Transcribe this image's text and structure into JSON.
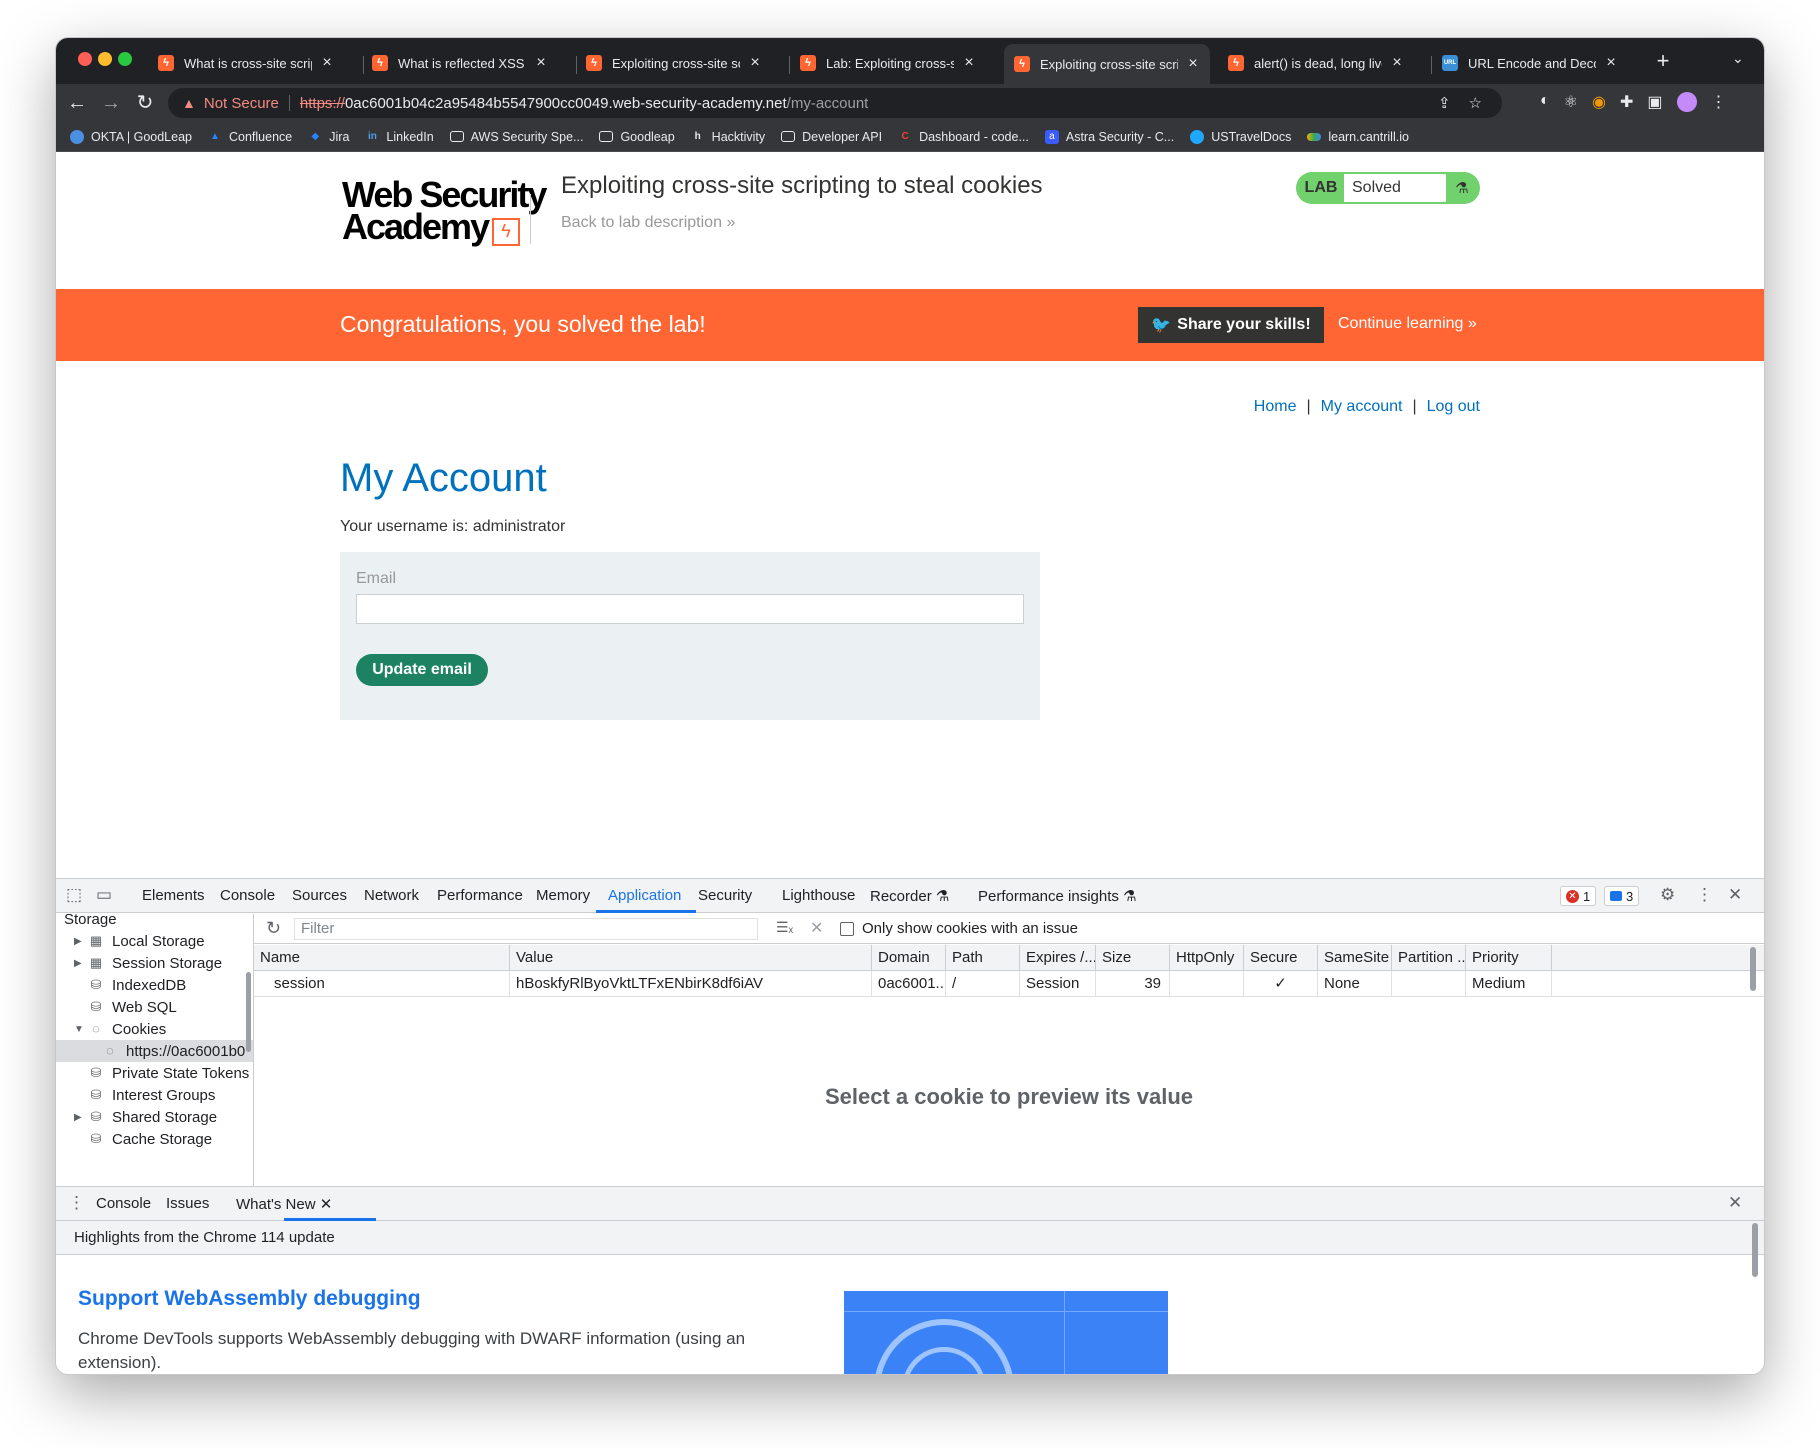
{
  "browser": {
    "tabs": [
      {
        "title": "What is cross-site scriptin",
        "favicon": "portswigger-icon",
        "active": false
      },
      {
        "title": "What is reflected XSS (cro",
        "favicon": "portswigger-icon",
        "active": false
      },
      {
        "title": "Exploiting cross-site scrip",
        "favicon": "portswigger-icon",
        "active": false
      },
      {
        "title": "Lab: Exploiting cross-site",
        "favicon": "portswigger-icon",
        "active": false
      },
      {
        "title": "Exploiting cross-site scrip",
        "favicon": "portswigger-icon",
        "active": true
      },
      {
        "title": "alert() is dead, long live pr",
        "favicon": "portswigger-icon",
        "active": false
      },
      {
        "title": "URL Encode and Decode -",
        "favicon": "url-icon",
        "active": false
      }
    ],
    "address": {
      "security_label": "Not Secure",
      "scheme": "https://",
      "host": "0ac6001b04c2a95484b5547900cc0049.web-security-academy.net",
      "path": "/my-account"
    },
    "bookmarks": [
      {
        "label": "OKTA | GoodLeap",
        "icon": "okta-icon",
        "color": "#4a90e2"
      },
      {
        "label": "Confluence",
        "icon": "confluence-icon",
        "color": "#2684ff"
      },
      {
        "label": "Jira",
        "icon": "jira-icon",
        "color": "#2684ff"
      },
      {
        "label": "LinkedIn",
        "icon": "linkedin-icon",
        "color": "#0a66c2"
      },
      {
        "label": "AWS Security Spe...",
        "icon": "folder-icon",
        "color": ""
      },
      {
        "label": "Goodleap",
        "icon": "folder-icon",
        "color": ""
      },
      {
        "label": "Hacktivity",
        "icon": "hackerone-icon",
        "color": ""
      },
      {
        "label": "Developer API",
        "icon": "folder-icon",
        "color": ""
      },
      {
        "label": "Dashboard - code...",
        "icon": "codecov-icon",
        "color": "#ea4335"
      },
      {
        "label": "Astra Security - C...",
        "icon": "astra-icon",
        "color": "#3b5bfd"
      },
      {
        "label": "USTravelDocs",
        "icon": "cloud-icon",
        "color": "#1ea7fd"
      },
      {
        "label": "learn.cantrill.io",
        "icon": "cantrill-icon",
        "color": "#f4b400"
      }
    ]
  },
  "site": {
    "logo_line1": "Web Security",
    "logo_line2": "Academy",
    "lab_title": "Exploiting cross-site scripting to steal cookies",
    "back_link": "Back to lab description",
    "lab_badge": {
      "tag": "LAB",
      "status": "Solved"
    },
    "banner": {
      "message": "Congratulations, you solved the lab!",
      "share_label": "Share your skills!",
      "continue_label": "Continue learning"
    },
    "nav": {
      "home": "Home",
      "my_account": "My account",
      "log_out": "Log out"
    },
    "heading": "My Account",
    "username_text": "Your username is: administrator",
    "email_label": "Email",
    "email_value": "",
    "update_button": "Update email"
  },
  "devtools": {
    "tabs": [
      "Elements",
      "Console",
      "Sources",
      "Network",
      "Performance",
      "Memory",
      "Application",
      "Security",
      "Lighthouse",
      "Recorder",
      "Performance insights"
    ],
    "active_tab": "Application",
    "error_count": "1",
    "message_count": "3",
    "sidebar": {
      "section": "Storage",
      "items": [
        {
          "label": "Local Storage",
          "expandable": true,
          "icon": "grid-icon"
        },
        {
          "label": "Session Storage",
          "expandable": true,
          "icon": "grid-icon"
        },
        {
          "label": "IndexedDB",
          "expandable": false,
          "icon": "database-icon"
        },
        {
          "label": "Web SQL",
          "expandable": false,
          "icon": "database-icon"
        },
        {
          "label": "Cookies",
          "expandable": true,
          "icon": "cookie-icon"
        },
        {
          "label": "https://0ac6001b0",
          "expandable": false,
          "icon": "cookie-icon"
        },
        {
          "label": "Private State Tokens",
          "expandable": false,
          "icon": "database-icon"
        },
        {
          "label": "Interest Groups",
          "expandable": false,
          "icon": "database-icon"
        },
        {
          "label": "Shared Storage",
          "expandable": true,
          "icon": "database-icon"
        },
        {
          "label": "Cache Storage",
          "expandable": false,
          "icon": "database-icon"
        }
      ]
    },
    "filter_placeholder": "Filter",
    "only_issues_label": "Only show cookies with an issue",
    "cookie_columns": [
      "Name",
      "Value",
      "Domain",
      "Path",
      "Expires /...",
      "Size",
      "HttpOnly",
      "Secure",
      "SameSite",
      "Partition ...",
      "Priority"
    ],
    "cookies": [
      {
        "name": "session",
        "value": "hBoskfyRlByoVktLTFxENbirK8df6iAV",
        "domain": "0ac6001...",
        "path": "/",
        "expires": "Session",
        "size": "39",
        "httponly": "",
        "secure": "✓",
        "samesite": "None",
        "partition": "",
        "priority": "Medium"
      }
    ],
    "preview_message": "Select a cookie to preview its value",
    "drawer": {
      "tabs": [
        "Console",
        "Issues",
        "What's New"
      ],
      "active": "What's New",
      "highlights": "Highlights from the Chrome 114 update",
      "article_title": "Support WebAssembly debugging",
      "article_text": "Chrome DevTools supports WebAssembly debugging with DWARF information (using an extension)."
    }
  }
}
